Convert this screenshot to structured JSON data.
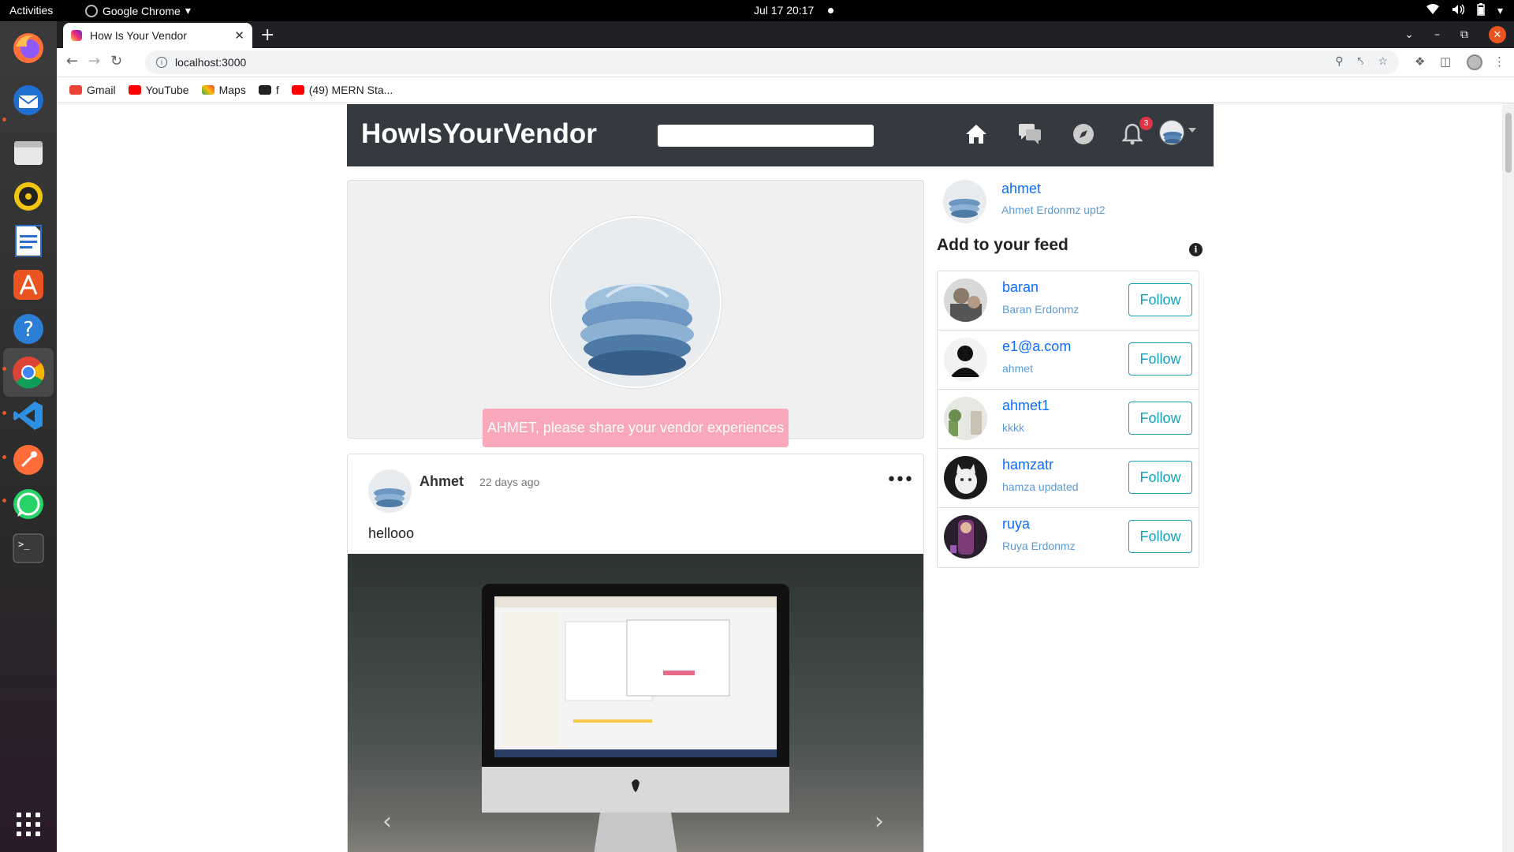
{
  "system": {
    "activities": "Activities",
    "app_menu": "Google Chrome",
    "clock": "Jul 17  20:17"
  },
  "browser": {
    "tab_title": "How Is Your Vendor",
    "url": "localhost:3000",
    "bookmarks": [
      {
        "label": "Gmail",
        "color": "#ea4335"
      },
      {
        "label": "YouTube",
        "color": "#ff0000"
      },
      {
        "label": "Maps",
        "color": "#34a853"
      },
      {
        "label": "f",
        "color": "#222222"
      },
      {
        "label": "(49) MERN Sta...",
        "color": "#ff0000"
      }
    ]
  },
  "app": {
    "brand": "HowIsYourVendor",
    "notification_count": "3",
    "share_prompt": "AHMET, please share your vendor experiences",
    "post": {
      "author": "Ahmet",
      "time": "22 days ago",
      "text": "hellooo",
      "more_icon": "•••"
    },
    "me": {
      "name": "ahmet",
      "desc": "Ahmet Erdonmz upt2"
    },
    "feed_title": "Add to your feed",
    "suggestions": [
      {
        "name": "baran",
        "sub": "Baran Erdonmz",
        "button": "Follow"
      },
      {
        "name": "e1@a.com",
        "sub": "ahmet",
        "button": "Follow"
      },
      {
        "name": "ahmet1",
        "sub": "kkkk",
        "button": "Follow"
      },
      {
        "name": "hamzatr",
        "sub": "hamza updated",
        "button": "Follow"
      },
      {
        "name": "ruya",
        "sub": "Ruya Erdonmz",
        "button": "Follow"
      }
    ]
  },
  "colors": {
    "navbar": "#343a40",
    "link": "#0d6efd",
    "follow": "#17a2b8",
    "share_button": "#f8a8b8",
    "badge": "#dc3545"
  }
}
